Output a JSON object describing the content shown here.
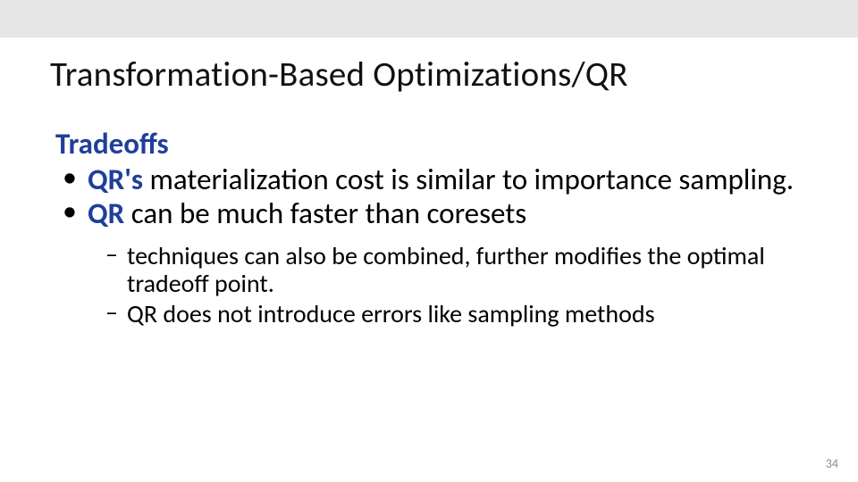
{
  "slide": {
    "title": "Transformation-Based Optimizations/QR",
    "heading": "Tradeoffs",
    "bullets": [
      {
        "prefix": "QR's ",
        "rest": "materialization cost is similar to importance sampling."
      },
      {
        "prefix": "QR ",
        "rest": "can be much faster than coresets"
      }
    ],
    "subbullets": [
      "techniques can also be combined, further modifies the optimal tradeoff point.",
      "QR does not introduce  errors like sampling methods"
    ],
    "page_number": "34"
  }
}
